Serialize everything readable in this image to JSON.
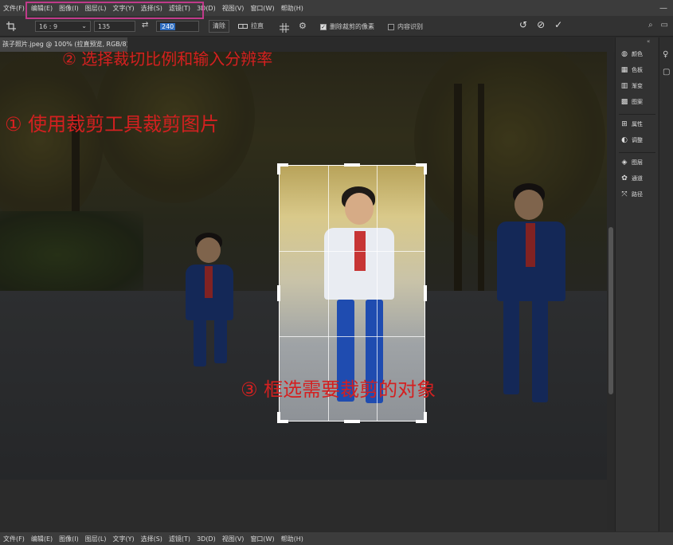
{
  "menu": [
    "文件(F)",
    "编辑(E)",
    "图像(I)",
    "图层(L)",
    "文字(Y)",
    "选择(S)",
    "滤镜(T)",
    "3D(D)",
    "视图(V)",
    "窗口(W)",
    "帮助(H)"
  ],
  "window_controls": [
    "—"
  ],
  "options_bar": {
    "ratio_value": "16 : 9",
    "width_value": "135",
    "height_value": "240",
    "clear_label": "清除",
    "straighten_label": "拉直",
    "delete_cropped_label": "删除裁剪的像素",
    "delete_cropped_checked": true,
    "content_aware_label": "内容识别",
    "content_aware_checked": false
  },
  "document_tab": "孩子照片.jpeg @ 100% (拉直预览, RGB/8)",
  "panels": [
    {
      "icon": "palette-icon",
      "label": "颜色"
    },
    {
      "icon": "swatches-icon",
      "label": "色板"
    },
    {
      "icon": "gradient-icon",
      "label": "渐变"
    },
    {
      "icon": "pattern-icon",
      "label": "图案"
    },
    {
      "icon": "properties-icon",
      "label": "属性"
    },
    {
      "icon": "adjustments-icon",
      "label": "调整"
    },
    {
      "icon": "layers-icon",
      "label": "图层"
    },
    {
      "icon": "channels-icon",
      "label": "通道"
    },
    {
      "icon": "paths-icon",
      "label": "路径"
    }
  ],
  "annotations": {
    "step1": "① 使用裁剪工具裁剪图片",
    "step2": "② 选择裁切比例和输入分辨率",
    "step3": "③ 框选需要裁剪的对象"
  },
  "colors": {
    "annotation_red": "#d42020",
    "highlight_box": "#c03a8a",
    "uniform_blue": "#1f3e86",
    "scarf_red": "#c73535"
  }
}
